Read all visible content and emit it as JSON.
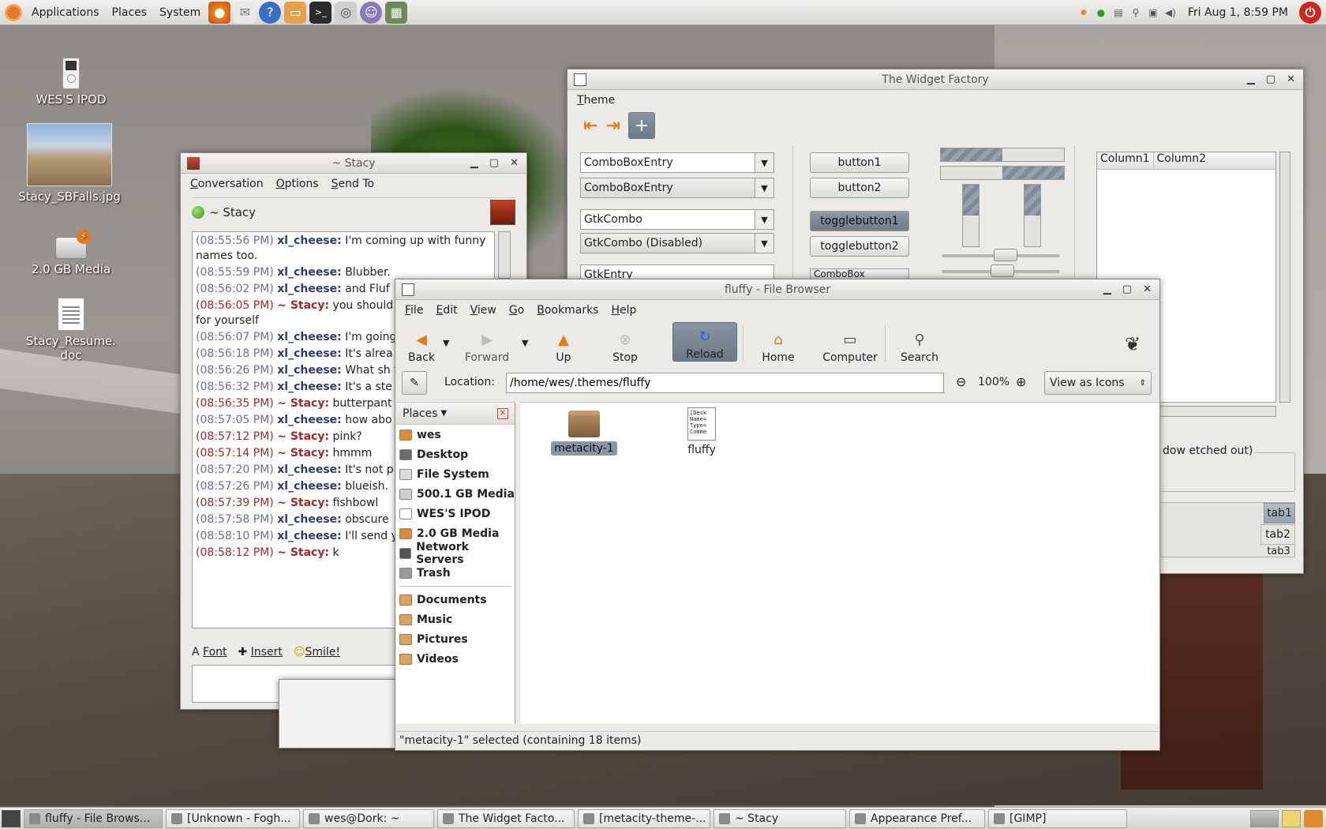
{
  "top_panel": {
    "menus": [
      "Applications",
      "Places",
      "System"
    ],
    "clock": "Fri Aug  1,  8:59 PM"
  },
  "desktop_icons": [
    {
      "label": "WES'S IPOD"
    },
    {
      "label": "Stacy_SBFalls.jpg"
    },
    {
      "label": "2.0 GB Media"
    },
    {
      "label": "Stacy_Resume.\ndoc"
    }
  ],
  "widget_factory": {
    "title": "The Widget Factory",
    "menu": [
      "Theme"
    ],
    "combos": [
      {
        "label": "ComboBoxEntry"
      },
      {
        "label": "ComboBoxEntry"
      },
      {
        "label": "GtkCombo"
      },
      {
        "label": "GtkCombo (Disabled)"
      },
      {
        "label": "GtkEntry"
      },
      {
        "label": "ComboBox"
      }
    ],
    "buttons": [
      "button1",
      "button2",
      "togglebutton1",
      "togglebutton2"
    ],
    "toggle_states": [
      true,
      false
    ],
    "progress_fractions": [
      0.5,
      0.5
    ],
    "columns": [
      "Column1",
      "Column2"
    ],
    "frame_label": "dow etched out)",
    "tabs": [
      "tab1",
      "tab2",
      "tab3"
    ]
  },
  "chat": {
    "title": "~ Stacy",
    "menu": [
      "Conversation",
      "Options",
      "Send To"
    ],
    "buddy": "~ Stacy",
    "messages": [
      {
        "time": "(08:55:56 PM)",
        "name": "xl_cheese:",
        "text": "I'm coming up with funny names too.",
        "me": false
      },
      {
        "time": "(08:55:59 PM)",
        "name": "xl_cheese:",
        "text": "Blubber.",
        "me": false
      },
      {
        "time": "(08:56:02 PM)",
        "name": "xl_cheese:",
        "text": "and Fluf",
        "me": false
      },
      {
        "time": "(08:56:05 PM)",
        "name": "~ Stacy:",
        "text": "you should wild hair.  keep it for yourself",
        "me": true
      },
      {
        "time": "(08:56:07 PM)",
        "name": "xl_cheese:",
        "text": "I'm going",
        "me": false
      },
      {
        "time": "(08:56:18 PM)",
        "name": "xl_cheese:",
        "text": "It's alrea keyboard.",
        "me": false
      },
      {
        "time": "(08:56:26 PM)",
        "name": "xl_cheese:",
        "text": "What sh third one?",
        "me": false
      },
      {
        "time": "(08:56:32 PM)",
        "name": "xl_cheese:",
        "text": "It's a ste",
        "me": false
      },
      {
        "time": "(08:56:35 PM)",
        "name": "~ Stacy:",
        "text": "butterpant",
        "me": true
      },
      {
        "time": "(08:57:05 PM)",
        "name": "xl_cheese:",
        "text": "how abo PinkButterpants.",
        "me": false
      },
      {
        "time": "(08:57:12 PM)",
        "name": "~ Stacy:",
        "text": "pink?",
        "me": true
      },
      {
        "time": "(08:57:14 PM)",
        "name": "~ Stacy:",
        "text": "hmmm",
        "me": true
      },
      {
        "time": "(08:57:20 PM)",
        "name": "xl_cheese:",
        "text": "It's not p",
        "me": false
      },
      {
        "time": "(08:57:26 PM)",
        "name": "xl_cheese:",
        "text": "blueish.",
        "me": false
      },
      {
        "time": "(08:57:39 PM)",
        "name": "~ Stacy:",
        "text": "fishbowl",
        "me": true
      },
      {
        "time": "(08:57:58 PM)",
        "name": "xl_cheese:",
        "text": "obscure",
        "me": false
      },
      {
        "time": "(08:58:10 PM)",
        "name": "xl_cheese:",
        "text": "I'll send y",
        "me": false
      },
      {
        "time": "(08:58:12 PM)",
        "name": "~ Stacy:",
        "text": "k",
        "me": true
      }
    ],
    "toolbar": {
      "font": "Font",
      "insert": "Insert",
      "smile": "Smile!"
    }
  },
  "file_browser": {
    "title": "fluffy - File Browser",
    "menu": [
      "File",
      "Edit",
      "View",
      "Go",
      "Bookmarks",
      "Help"
    ],
    "toolbar": {
      "back": "Back",
      "forward": "Forward",
      "up": "Up",
      "stop": "Stop",
      "reload": "Reload",
      "home": "Home",
      "computer": "Computer",
      "search": "Search"
    },
    "location_label": "Location:",
    "location": "/home/wes/.themes/fluffy",
    "zoom": "100%",
    "view_mode": "View as Icons",
    "sidebar_title": "Places",
    "places": [
      "wes",
      "Desktop",
      "File System",
      "500.1 GB Media",
      "WES'S IPOD",
      "2.0 GB Media",
      "Network Servers",
      "Trash"
    ],
    "bookmarks": [
      "Documents",
      "Music",
      "Pictures",
      "Videos"
    ],
    "files": [
      {
        "name": "metacity-1",
        "type": "folder",
        "selected": true
      },
      {
        "name": "fluffy",
        "type": "file",
        "preview": "[Desk\nName=\nType=\nComme",
        "selected": false
      }
    ],
    "status": "\"metacity-1\" selected (containing 18 items)"
  },
  "taskbar": [
    {
      "label": "fluffy - File Brows...",
      "active": true
    },
    {
      "label": "[Unknown - Fogh...",
      "active": false
    },
    {
      "label": "wes@Dork: ~",
      "active": false
    },
    {
      "label": "The Widget Facto...",
      "active": false
    },
    {
      "label": "[metacity-theme-...",
      "active": false
    },
    {
      "label": "~ Stacy",
      "active": false
    },
    {
      "label": "Appearance Pref...",
      "active": false
    },
    {
      "label": "[GIMP]",
      "active": false
    }
  ]
}
